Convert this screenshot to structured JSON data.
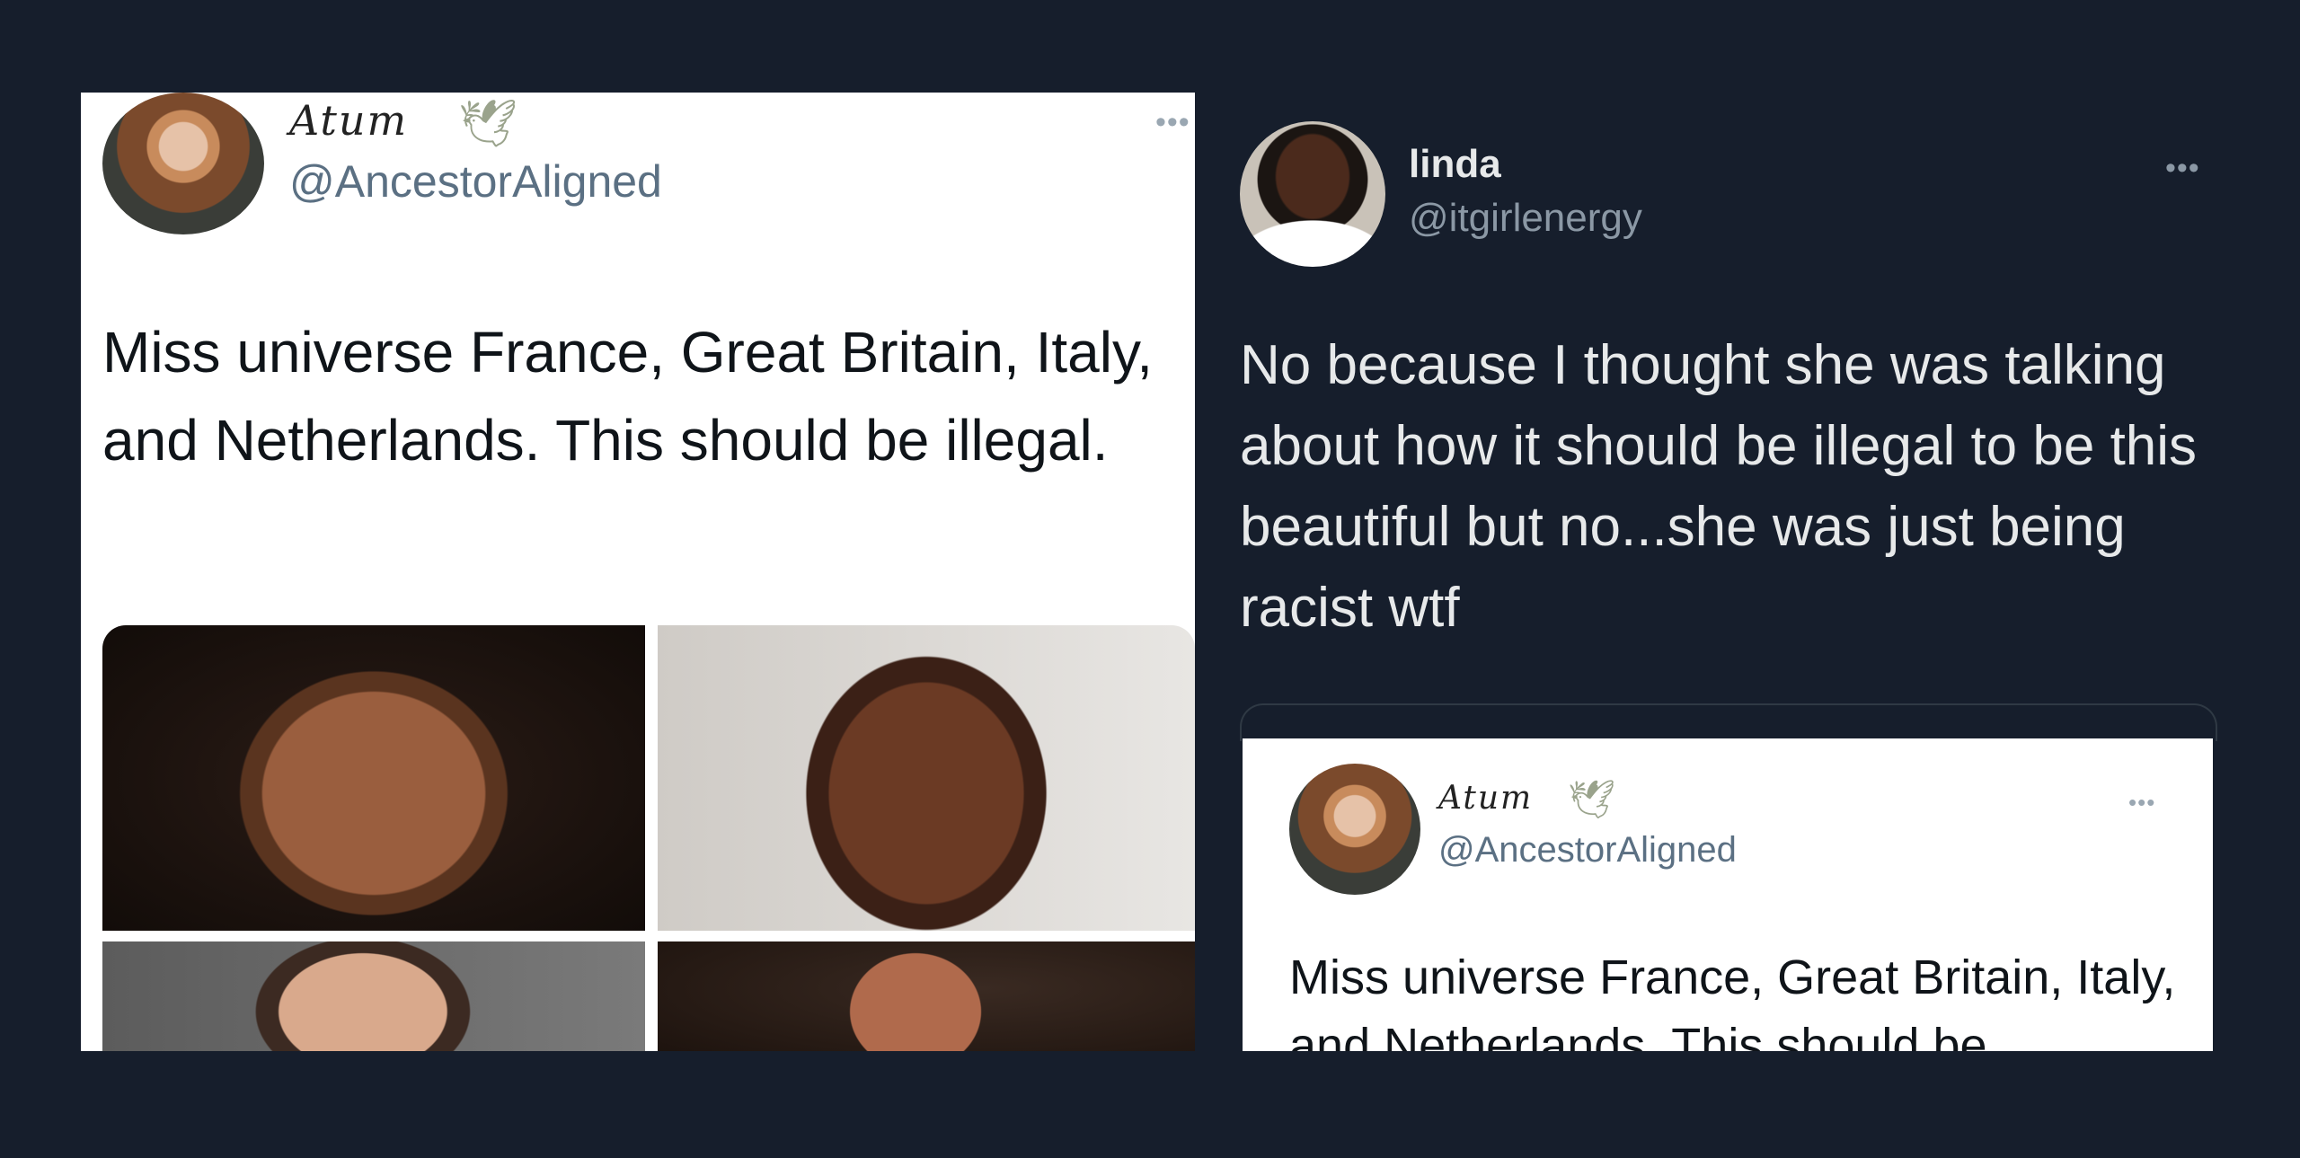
{
  "left_tweet": {
    "display_name": "Atum",
    "handle": "@AncestorAligned",
    "menu_icon": "•••",
    "text": "Miss universe France, Great Britain, Italy, and Netherlands. This should be illegal.",
    "dove_icon": "🕊"
  },
  "right_tweet": {
    "display_name": "linda",
    "handle": "@itgirlenergy",
    "menu_icon": "•••",
    "text": "No because I thought she was talking about how it should be illegal to be this beautiful but no...she was just being racist wtf"
  },
  "quoted_tweet": {
    "display_name": "Atum",
    "handle": "@AncestorAligned",
    "menu_icon": "•••",
    "dove_icon": "🕊",
    "text": "Miss universe France, Great Britain, Italy, and Netherlands. This should be"
  },
  "colors": {
    "background": "#161e2c",
    "dark_text": "#e7e9ea",
    "muted_text": "#8b98a5"
  }
}
